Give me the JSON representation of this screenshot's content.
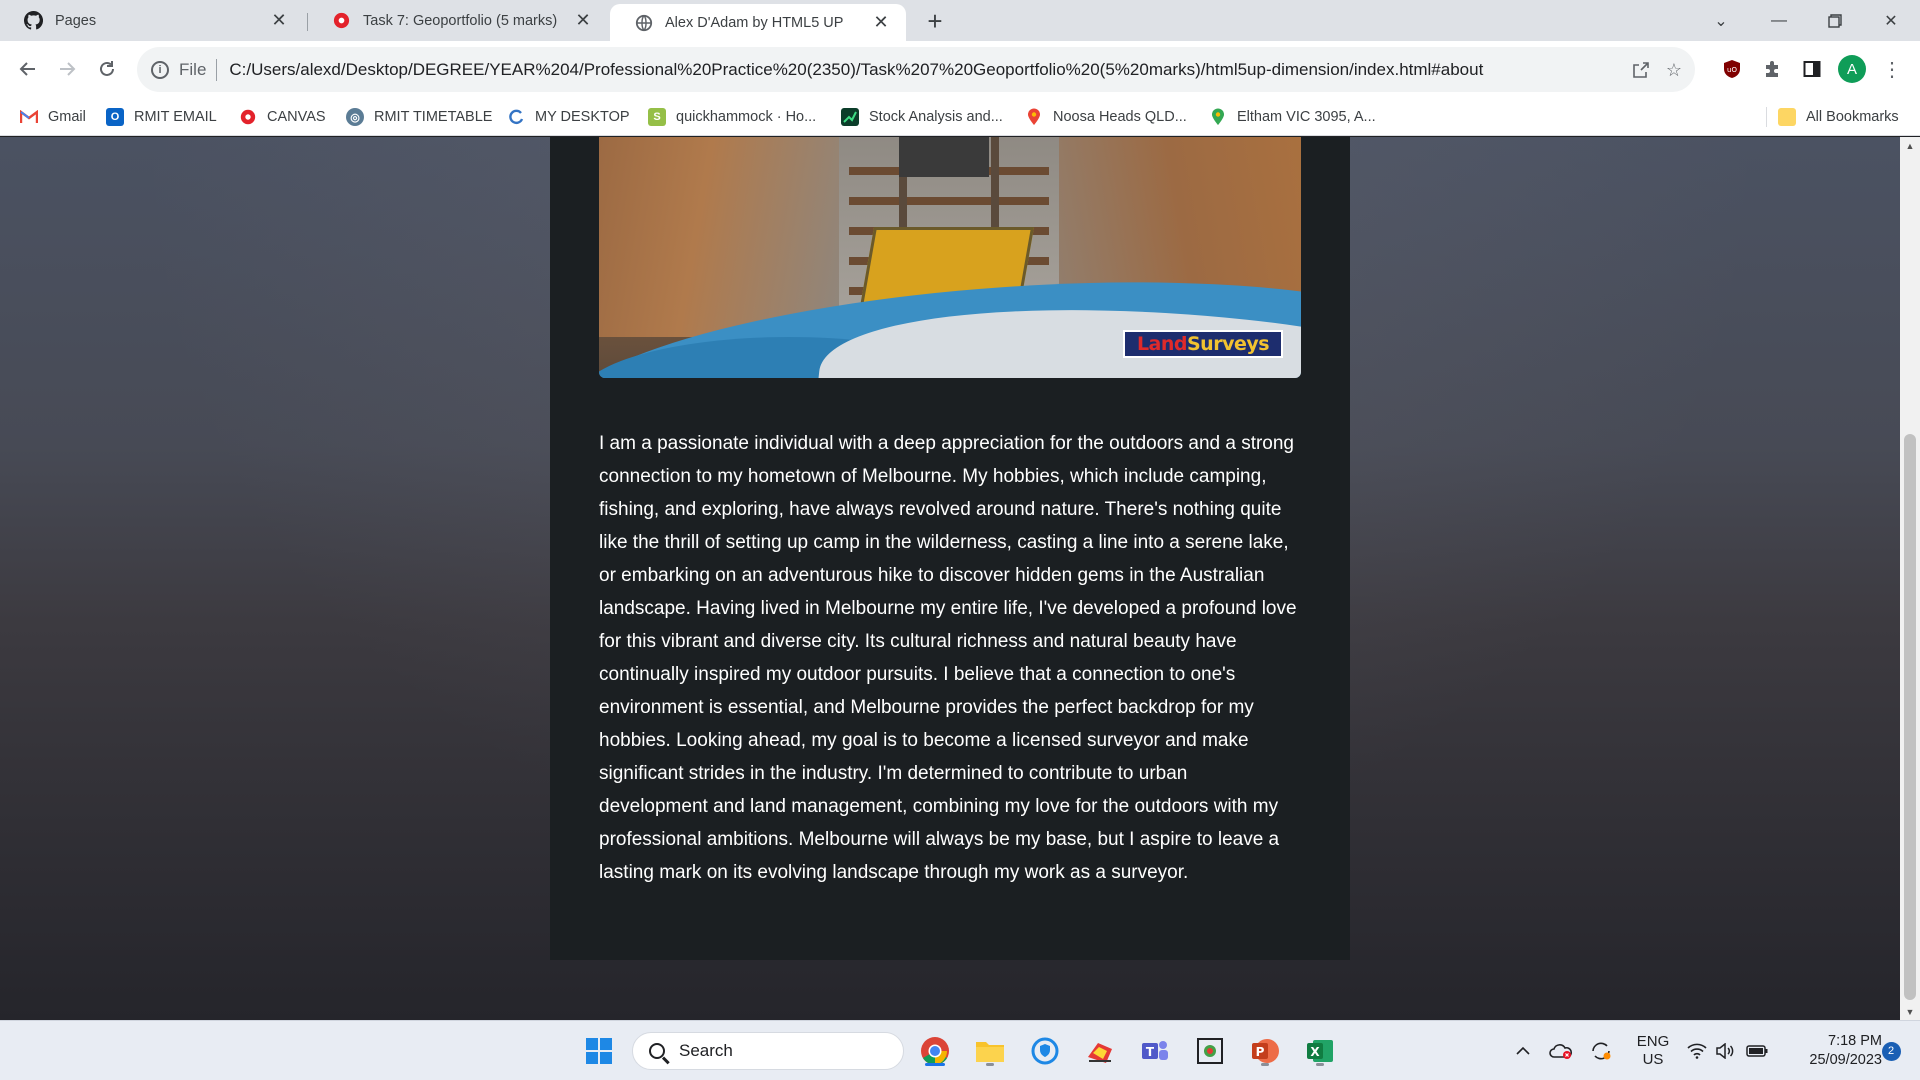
{
  "browser": {
    "tabs": [
      {
        "title": "Pages",
        "icon": "github-icon"
      },
      {
        "title": "Task 7: Geoportfolio (5 marks)",
        "icon": "canvas-icon"
      },
      {
        "title": "Alex D'Adam by HTML5 UP",
        "icon": "globe-icon",
        "active": true
      }
    ],
    "omnibox": {
      "scheme_label": "File",
      "url": "C:/Users/alexd/Desktop/DEGREE/YEAR%204/Professional%20Practice%20(2350)/Task%207%20Geoportfolio%20(5%20marks)/html5up-dimension/index.html#about"
    },
    "profile_initial": "A",
    "bookmarks": [
      {
        "label": "Gmail",
        "icon": "gmail-icon"
      },
      {
        "label": "RMIT EMAIL",
        "icon": "outlook-icon"
      },
      {
        "label": "CANVAS",
        "icon": "canvas-icon"
      },
      {
        "label": "RMIT TIMETABLE",
        "icon": "timetable-icon"
      },
      {
        "label": "MY DESKTOP",
        "icon": "desktop-icon"
      },
      {
        "label": "quickhammock · Ho...",
        "icon": "shopify-icon"
      },
      {
        "label": "Stock Analysis and...",
        "icon": "chart-icon"
      },
      {
        "label": "Noosa Heads QLD...",
        "icon": "map-pin-icon"
      },
      {
        "label": "Eltham VIC 3095, A...",
        "icon": "map-pin-icon"
      }
    ],
    "all_bookmarks_label": "All Bookmarks"
  },
  "page": {
    "logo_text_part1": "Land",
    "logo_text_part2": "Surveys",
    "about_paragraph": "I am a passionate individual with a deep appreciation for the outdoors and a strong connection to my hometown of Melbourne. My hobbies, which include camping, fishing, and exploring, have always revolved around nature. There's nothing quite like the thrill of setting up camp in the wilderness, casting a line into a serene lake, or embarking on an adventurous hike to discover hidden gems in the Australian landscape. Having lived in Melbourne my entire life, I've developed a profound love for this vibrant and diverse city. Its cultural richness and natural beauty have continually inspired my outdoor pursuits. I believe that a connection to one's environment is essential, and Melbourne provides the perfect backdrop for my hobbies. Looking ahead, my goal is to become a licensed surveyor and make significant strides in the industry. I'm determined to contribute to urban development and land management, combining my love for the outdoors with my professional ambitions. Melbourne will always be my base, but I aspire to leave a lasting mark on its evolving landscape through my work as a surveyor."
  },
  "taskbar": {
    "search_placeholder": "Search",
    "language_line1": "ENG",
    "language_line2": "US",
    "time": "7:18 PM",
    "date": "25/09/2023",
    "notification_count": "2"
  },
  "colors": {
    "accent_chrome": "#1a73e8",
    "page_card": "#1b1f22",
    "profile": "#0f9d58"
  }
}
